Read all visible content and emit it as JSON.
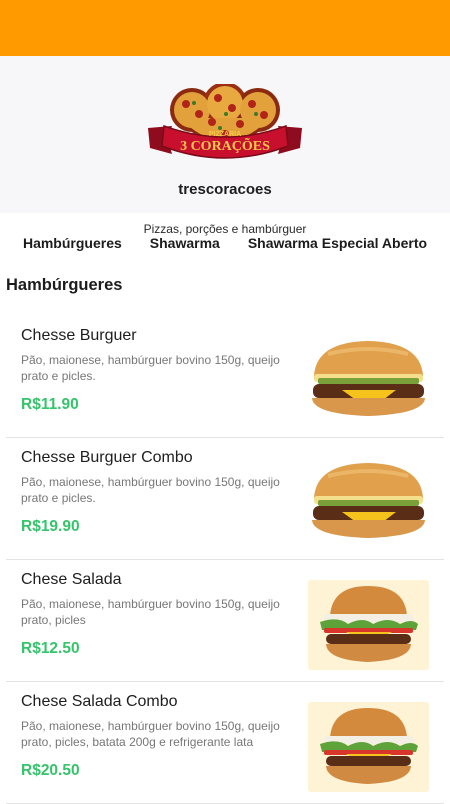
{
  "store": {
    "logo_text_top": "PIZZARIA",
    "logo_text_main": "3 CORAÇÕES",
    "name": "trescoracoes",
    "description": "Pizzas, porções e hambúrguer"
  },
  "tabs": [
    {
      "label": "Hambúrgueres"
    },
    {
      "label": "Shawarma"
    },
    {
      "label": "Shawarma Especial Aberto"
    }
  ],
  "section": {
    "title": "Hambúrgueres"
  },
  "items": [
    {
      "name": "Chesse Burguer",
      "description": "Pão, maionese, hambúrguer bovino 150g, queijo prato e picles.",
      "price": "R$11.90",
      "image": "cheeseburger-icon"
    },
    {
      "name": "Chesse Burguer Combo",
      "description": "Pão, maionese, hambúrguer bovino 150g, queijo prato e picles.",
      "price": "R$19.90",
      "image": "cheeseburger-icon"
    },
    {
      "name": "Chese Salada",
      "description": "Pão, maionese, hambúrguer bovino 150g, queijo prato, picles",
      "price": "R$12.50",
      "image": "salad-burger-icon"
    },
    {
      "name": "Chese Salada Combo",
      "description": "Pão, maionese, hambúrguer bovino 150g, queijo prato, picles, batata 200g e refrigerante lata",
      "price": "R$20.50",
      "image": "salad-burger-icon"
    }
  ],
  "colors": {
    "header": "#ff9a00",
    "price": "#35c46b",
    "logo_red": "#c8102e"
  }
}
